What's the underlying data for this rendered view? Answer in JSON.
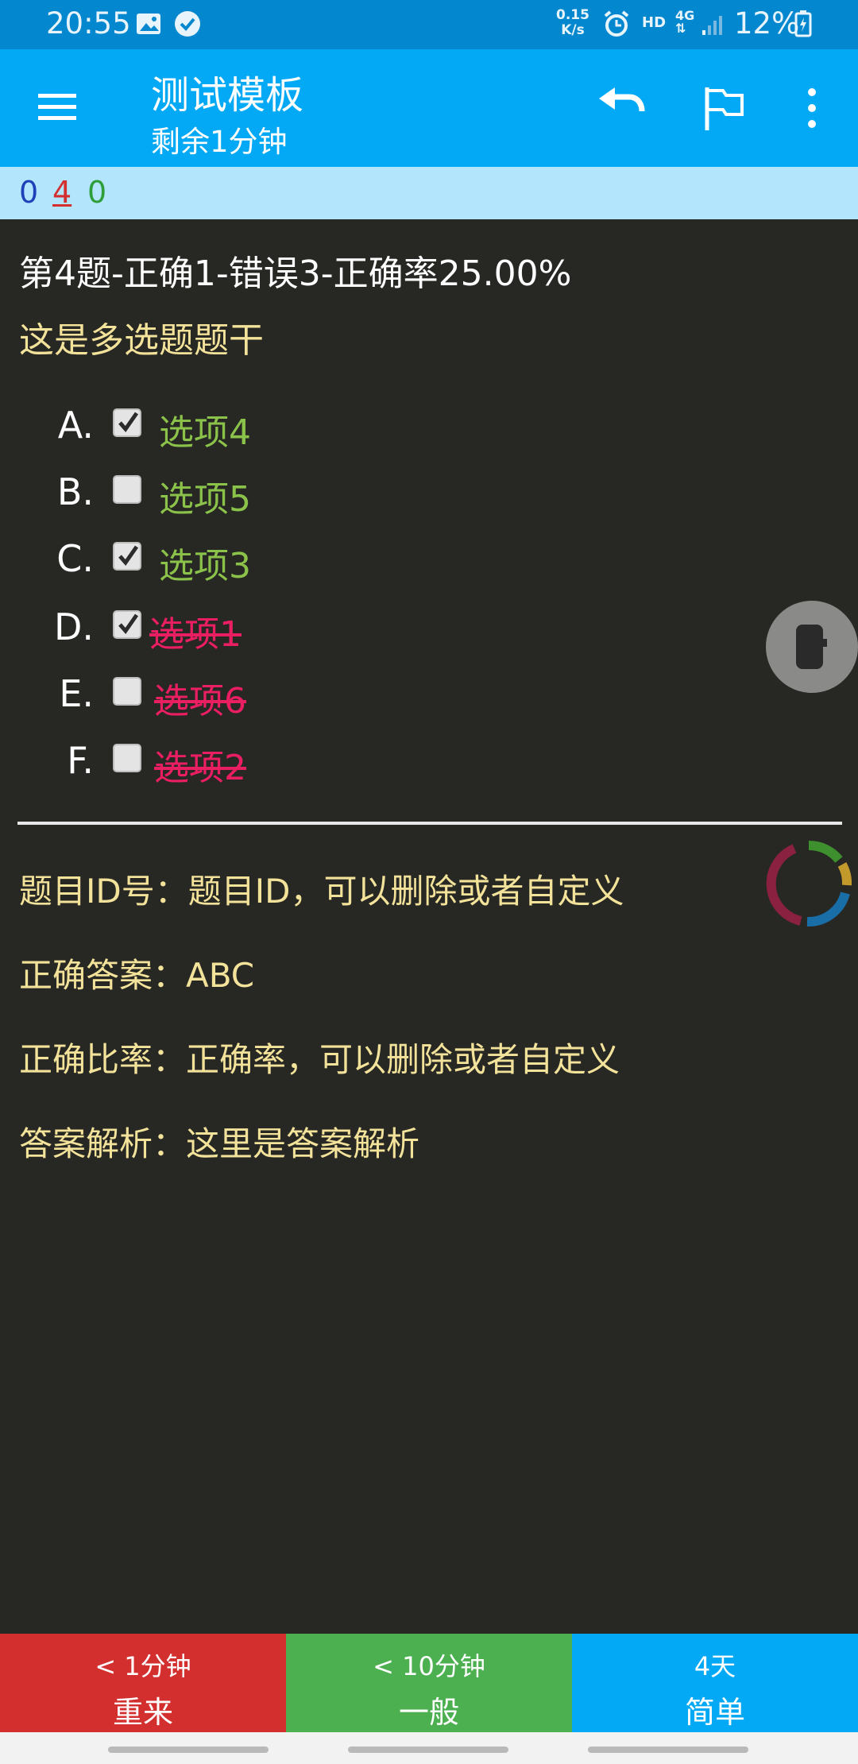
{
  "status_bar": {
    "time": "20:55",
    "net_speed_value": "0.15",
    "net_speed_unit": "K/s",
    "hd": "HD",
    "network": "4G",
    "battery": "12%"
  },
  "app_bar": {
    "title": "测试模板",
    "subtitle": "剩余1分钟",
    "icons": [
      "menu-icon",
      "undo-icon",
      "flag-icon",
      "more-vert-icon"
    ]
  },
  "counters": {
    "new": "0",
    "learning": "4",
    "review": "0",
    "colors": {
      "new": "#1e40b8",
      "learning": "#d32f2f",
      "review": "#2e9e3a"
    }
  },
  "question": {
    "header": "第4题-正确1-错误3-正确率25.00%",
    "stem": "这是多选题题干",
    "options": [
      {
        "letter": "A.",
        "label": "选项4",
        "checked": true,
        "status": "correct"
      },
      {
        "letter": "B.",
        "label": "选项5",
        "checked": false,
        "status": "correct"
      },
      {
        "letter": "C.",
        "label": "选项3",
        "checked": true,
        "status": "correct"
      },
      {
        "letter": "D.",
        "label": "选项1",
        "checked": true,
        "status": "wrong"
      },
      {
        "letter": "E.",
        "label": "选项6",
        "checked": false,
        "status": "wrong"
      },
      {
        "letter": "F.",
        "label": "选项2",
        "checked": false,
        "status": "wrong"
      }
    ]
  },
  "info": {
    "id_line": "题目ID号：题目ID，可以删除或者自定义",
    "answer_line": "正确答案：ABC",
    "rate_line": "正确比率：正确率，可以删除或者自定义",
    "analysis_line": "答案解析：这里是答案解析"
  },
  "buttons": {
    "again": {
      "interval": "< 1分钟",
      "label": "重来",
      "color": "#d32f2f"
    },
    "good": {
      "interval": "< 10分钟",
      "label": "一般",
      "color": "#4caf50"
    },
    "easy": {
      "interval": "4天",
      "label": "简单",
      "color": "#03a9f4"
    }
  }
}
